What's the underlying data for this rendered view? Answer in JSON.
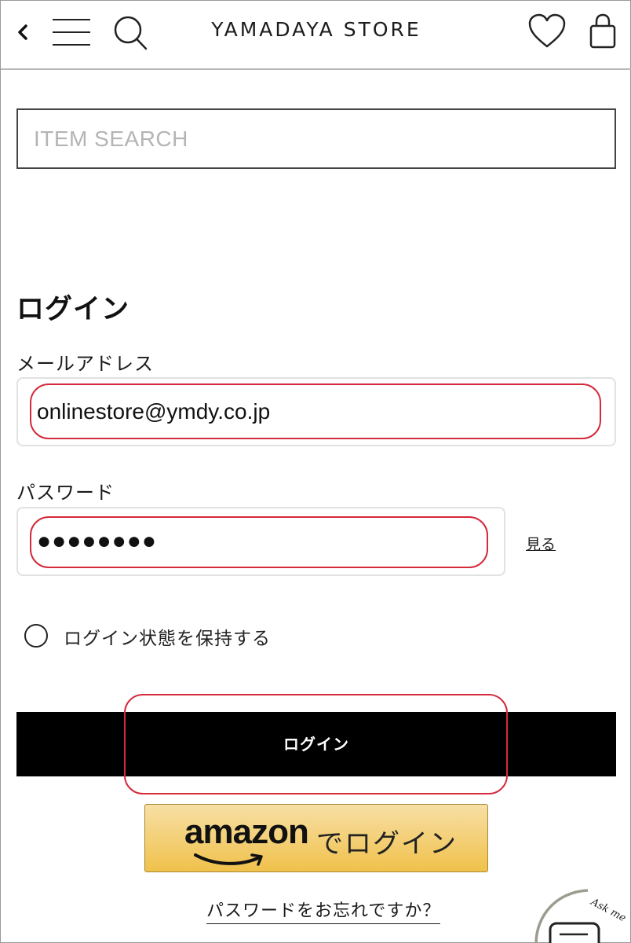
{
  "header": {
    "store_title": "YAMADAYA STORE",
    "icons": [
      "back-icon",
      "menu-icon",
      "search-icon",
      "heart-icon",
      "bag-icon"
    ]
  },
  "search": {
    "placeholder": "ITEM SEARCH"
  },
  "login": {
    "heading": "ログイン",
    "email_label": "メールアドレス",
    "email_value": "onlinestore@ymdy.co.jp",
    "password_label": "パスワード",
    "password_mask": "●●●●●●●●",
    "show_label": "見る",
    "remember_label": "ログイン状態を保持する",
    "button_label": "ログイン"
  },
  "amazon": {
    "logo_text": "amazon",
    "suffix": "でログイン"
  },
  "forgot_password": "パスワードをお忘れですか？",
  "chat_widget": {
    "text": "Ask me"
  },
  "colors": {
    "highlight": "#d42a3c",
    "login_button": "#000000",
    "amazon_gold": "#f0c14b"
  }
}
